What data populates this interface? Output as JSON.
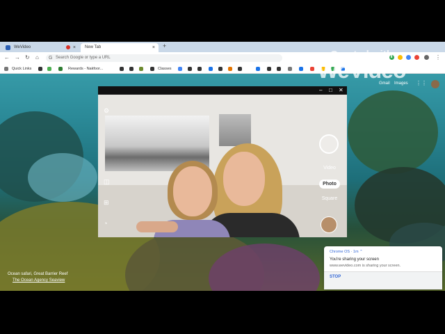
{
  "tabs": [
    {
      "label": "WeVideo",
      "active": false
    },
    {
      "label": "New Tab",
      "active": true
    }
  ],
  "omnibox": {
    "placeholder": "Search Google or type a URL"
  },
  "bookmarks": {
    "quick_links": "Quick Links",
    "rewards": "Rewards - Nakfoor...",
    "classes": "Classes"
  },
  "watermark": {
    "line1": "Created with",
    "line2": "WeVideo"
  },
  "google_links": {
    "gmail": "Gmail",
    "images": "Images"
  },
  "camera": {
    "modes": {
      "video": "Video",
      "photo": "Photo",
      "square": "Square"
    },
    "controls": {
      "minimize": "–",
      "maximize": "□",
      "close": "✕"
    }
  },
  "background_caption": {
    "title": "Ocean safari, Great Barrier Reef",
    "credit": "The Ocean Agency Seaview"
  },
  "notification": {
    "header": "Chrome OS · 1m ⌃",
    "title": "You're sharing your screen",
    "body": "www.wevideo.com is sharing your screen.",
    "stop": "STOP"
  },
  "colors": {
    "accent": "#3367d6",
    "tabbar": "#c9d8e8",
    "recording": "#d93025"
  }
}
